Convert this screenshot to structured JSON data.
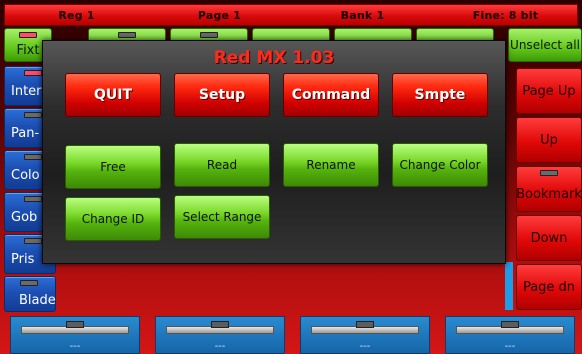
{
  "topbar": {
    "reg": "Reg 1",
    "page": "Page 1",
    "bank": "Bank 1",
    "fine": "Fine: 8 bit"
  },
  "top_row": {
    "fixture_label": "Fixt",
    "unselect_all_label": "Unselect all"
  },
  "left_sidebar": [
    {
      "label": "Inter"
    },
    {
      "label": "Pan-"
    },
    {
      "label": "Colo"
    },
    {
      "label": "Gob"
    },
    {
      "label": "Pris"
    },
    {
      "label": "Blade"
    }
  ],
  "right_sidebar": {
    "page_up": "Page Up",
    "up": "Up",
    "bookmark": "Bookmark",
    "down": "Down",
    "page_dn": "Page dn"
  },
  "dialog": {
    "title": "Red MX 1.03",
    "red_buttons": [
      "QUIT",
      "Setup",
      "Command",
      "Smpte"
    ],
    "green_buttons_row1": [
      "Free",
      "Read",
      "Rename",
      "Change Color"
    ],
    "green_buttons_row2": [
      "Change ID",
      "Select Range"
    ]
  },
  "faders": [
    {
      "value": "---"
    },
    {
      "value": "---"
    },
    {
      "value": "---"
    },
    {
      "value": "---"
    }
  ]
}
